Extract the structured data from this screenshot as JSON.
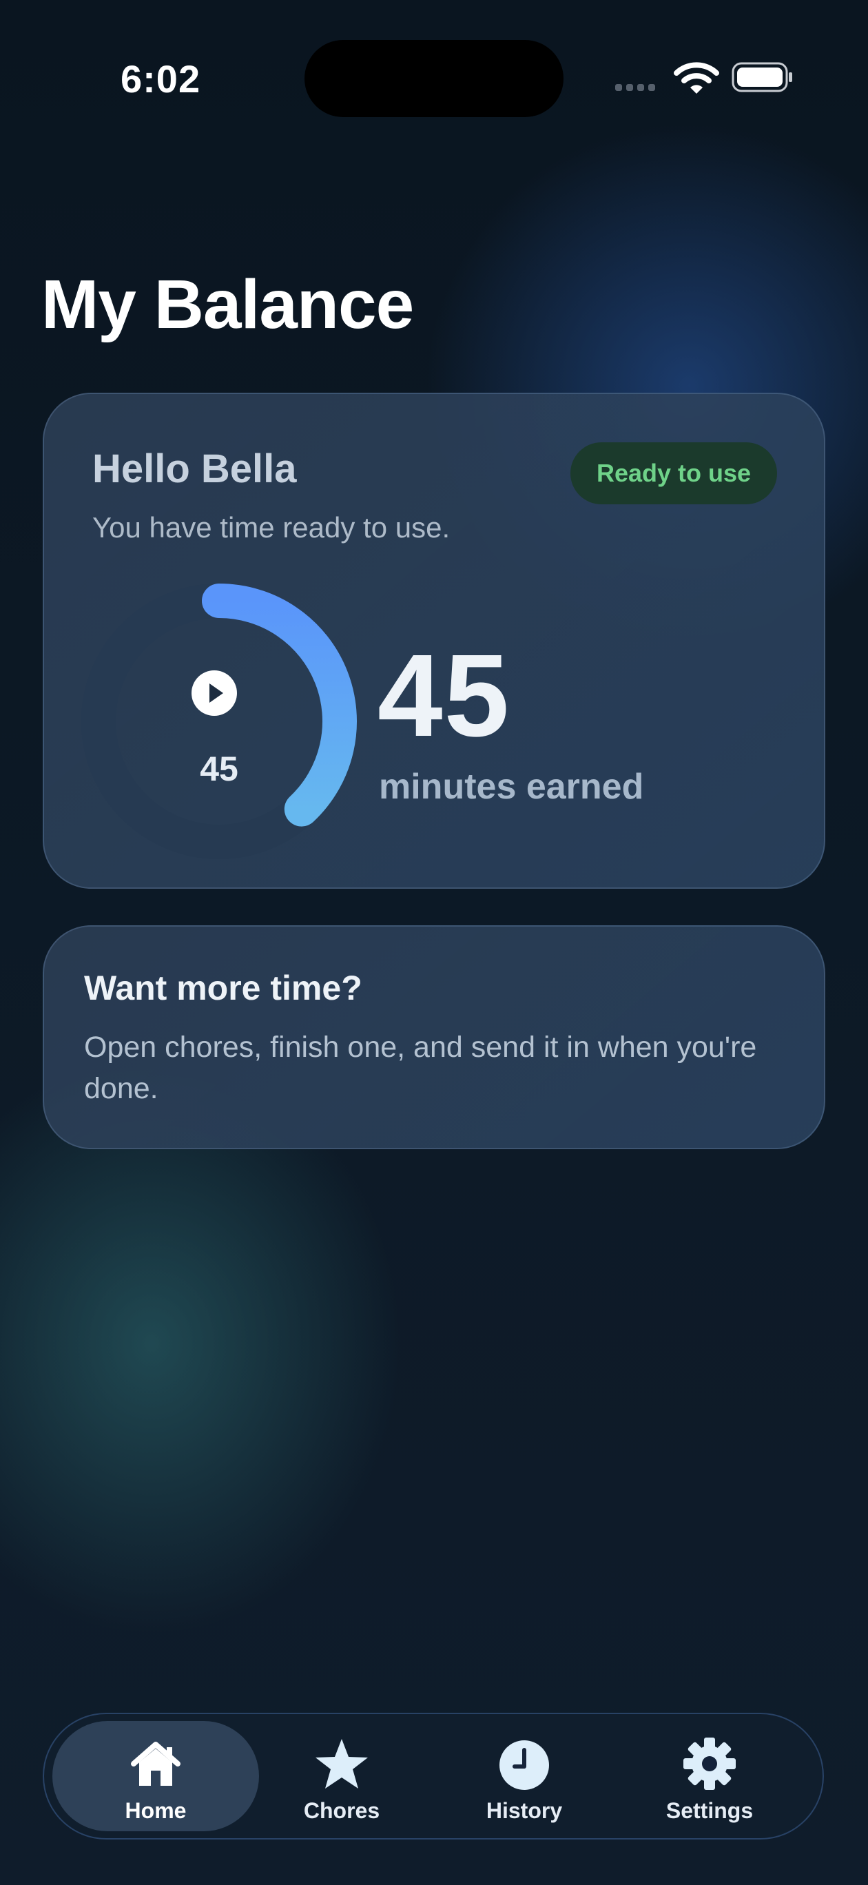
{
  "status_bar": {
    "time": "6:02"
  },
  "page": {
    "title": "My Balance"
  },
  "balance_card": {
    "greeting": "Hello Bella",
    "subtitle": "You have time ready to use.",
    "badge": "Ready to use",
    "ring_value": "45",
    "ring_progress": 0.38,
    "minutes": "45",
    "minutes_label": "minutes earned"
  },
  "more_card": {
    "title": "Want more time?",
    "text": "Open chores, finish one, and send it in when you're done."
  },
  "tab_bar": {
    "selected": "Home",
    "tabs": [
      {
        "label": "Home",
        "icon": "house-icon"
      },
      {
        "label": "Chores",
        "icon": "star-icon"
      },
      {
        "label": "History",
        "icon": "clock-icon"
      },
      {
        "label": "Settings",
        "icon": "gear-icon"
      }
    ]
  },
  "colors": {
    "background": "#0c1622",
    "accent": "#5a9dfa",
    "badge_text": "#6fd289"
  }
}
